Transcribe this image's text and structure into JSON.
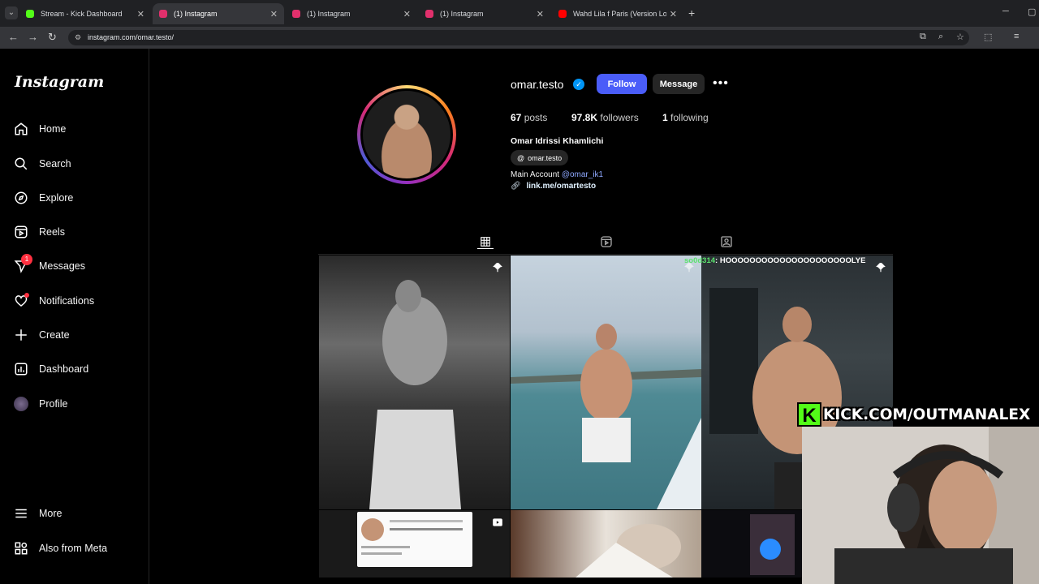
{
  "browser": {
    "tabs": [
      {
        "title": "Stream - Kick Dashboard",
        "favicon_color": "#53fc18"
      },
      {
        "title": "(1) Instagram",
        "favicon_color": "#e1306c"
      },
      {
        "title": "(1) Instagram",
        "favicon_color": "#e1306c"
      },
      {
        "title": "(1) Instagram",
        "favicon_color": "#e1306c"
      },
      {
        "title": "Wahd Lila f Paris (Version Long",
        "favicon_color": "#ff0000"
      }
    ],
    "url": "instagram.com/omar.testo/"
  },
  "sidebar": {
    "logo": "Instagram",
    "items": [
      {
        "label": "Home",
        "icon": "home-icon"
      },
      {
        "label": "Search",
        "icon": "search-icon"
      },
      {
        "label": "Explore",
        "icon": "explore-icon"
      },
      {
        "label": "Reels",
        "icon": "reels-icon"
      },
      {
        "label": "Messages",
        "icon": "messages-icon",
        "badge": "1"
      },
      {
        "label": "Notifications",
        "icon": "heart-icon"
      },
      {
        "label": "Create",
        "icon": "plus-icon"
      },
      {
        "label": "Dashboard",
        "icon": "dashboard-icon"
      },
      {
        "label": "Profile",
        "icon": "profile-avatar-icon"
      }
    ],
    "bottom": [
      {
        "label": "More",
        "icon": "menu-icon"
      },
      {
        "label": "Also from Meta",
        "icon": "meta-icon"
      }
    ]
  },
  "profile": {
    "username": "omar.testo",
    "follow_label": "Follow",
    "message_label": "Message",
    "stats": {
      "posts_count": "67",
      "posts_label": "posts",
      "followers_count": "97.8K",
      "followers_label": "followers",
      "following_count": "1",
      "following_label": "following"
    },
    "full_name": "Omar Idrissi Khamlichi",
    "threads_handle": "omar.testo",
    "bio_prefix": "Main Account",
    "bio_mention": "@omar_ik1",
    "link": "link.me/omartesto"
  },
  "overlays": {
    "chat_user": "so0d314",
    "chat_message": ": HOOOOOOOOOOOOOOOOOOOOOLYE",
    "kick_banner": "KICK.COM/OUTMANALEX"
  },
  "colors": {
    "accent_follow": "#4a5df9",
    "verified": "#0095f6",
    "badge": "#ff3040",
    "kick_green": "#53fc18"
  }
}
